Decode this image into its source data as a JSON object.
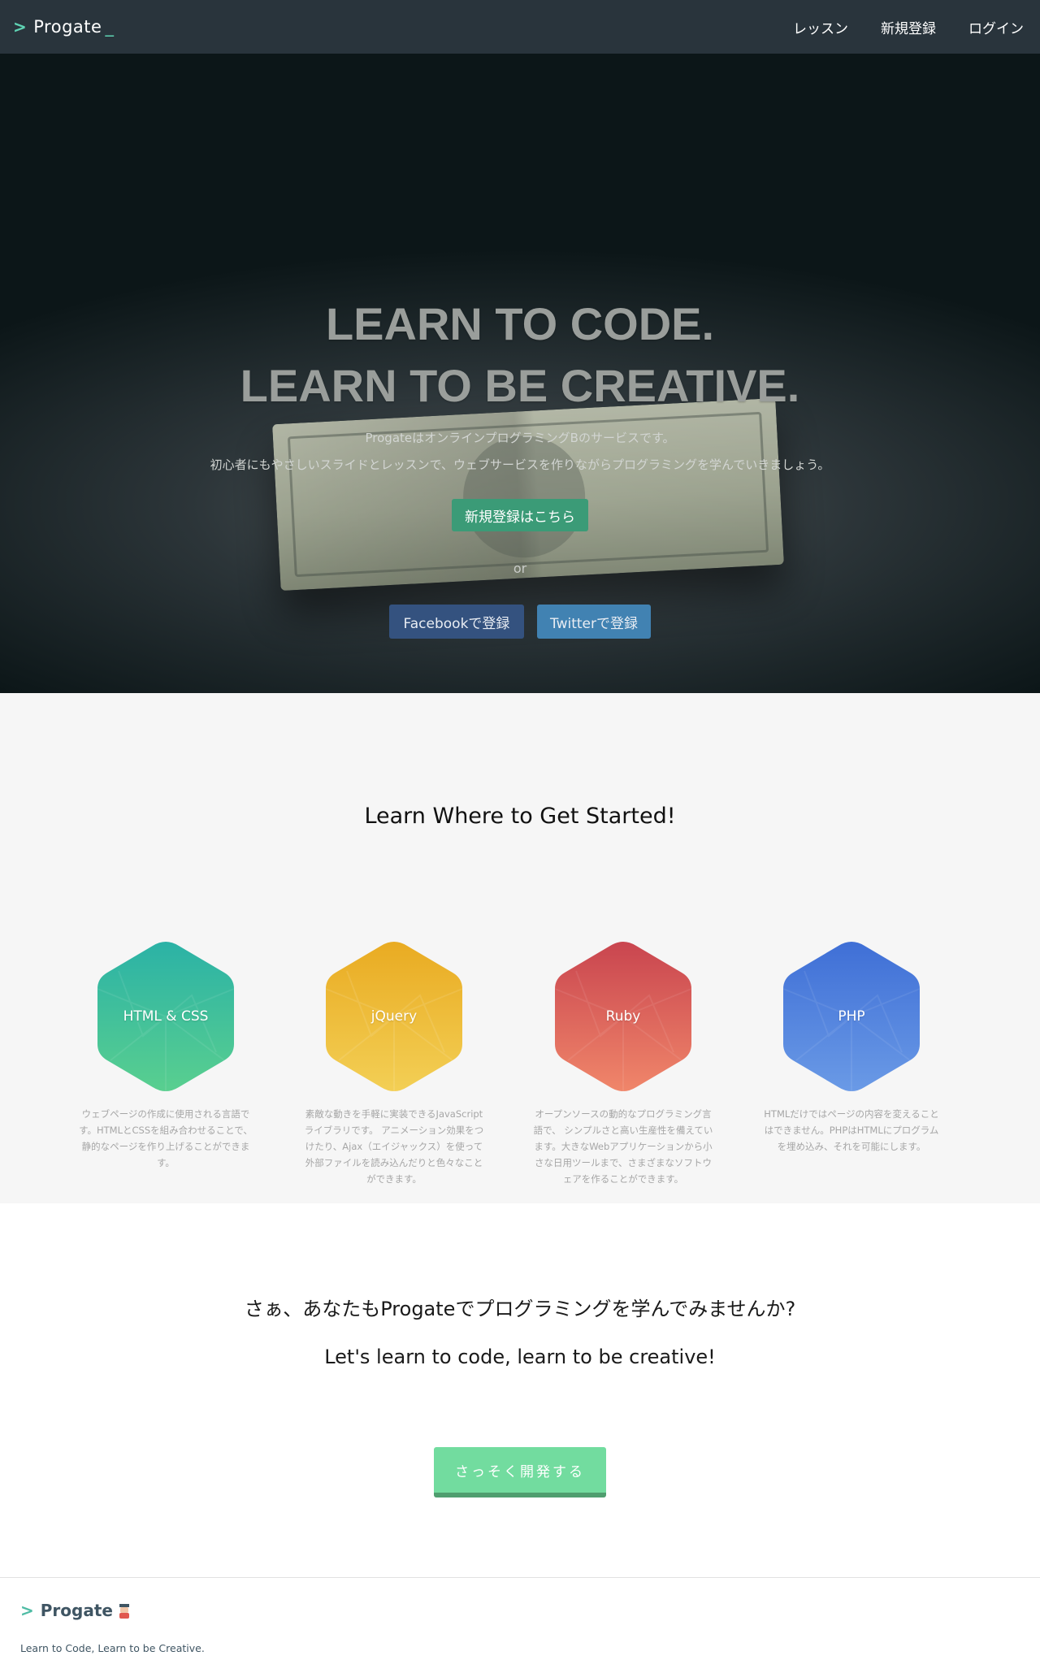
{
  "header": {
    "logo_text": "Progate",
    "logo_cursor": "_",
    "nav": [
      "レッスン",
      "新規登録",
      "ログイン"
    ]
  },
  "hero": {
    "title_line1": "LEARN TO CODE.",
    "title_line2": "LEARN TO BE CREATIVE.",
    "subtitle_line1": "ProgateはオンラインプログラミングBのサービスです。",
    "subtitle_line2": "初心者にもやさしいスライドとレッスンで、ウェブサービスを作りながらプログラミングを学んでいきましょう。",
    "signup_label": "新規登録はこちら",
    "or_label": "or",
    "facebook_label": "Facebookで登録",
    "twitter_label": "Twitterで登録"
  },
  "courses": {
    "title": "Learn Where to Get Started!",
    "items": [
      {
        "name": "HTML & CSS",
        "color_top": "#2bb2a6",
        "color_bottom": "#59cf8f",
        "desc": "ウェブページの作成に使用される言語です。HTMLとCSSを組み合わせることで、静的なページを作り上げることができます。"
      },
      {
        "name": "jQuery",
        "color_top": "#e9ab22",
        "color_bottom": "#f3cf55",
        "desc": "素敵な動きを手軽に実装できるJavaScriptライブラリです。 アニメーション効果をつけたり、Ajax（エイジャックス）を使って外部ファイルを読み込んだりと色々なことができます。"
      },
      {
        "name": "Ruby",
        "color_top": "#c9454f",
        "color_bottom": "#f0866a",
        "desc": "オープンソースの動的なプログラミング言語で、 シンプルさと高い生産性を備えています。大きなWebアプリケーションから小さな日用ツールまで、さまざまなソフトウェアを作ることができます。"
      },
      {
        "name": "PHP",
        "color_top": "#3f6fd6",
        "color_bottom": "#6a9ae6",
        "desc": "HTMLだけではページの内容を変えることはできません。PHPはHTMLにプログラムを埋め込み、それを可能にします。"
      }
    ]
  },
  "cta": {
    "jp_text": "さぁ、あなたもProgateでプログラミングを学んでみませんか?",
    "en_text": "Let's learn to code, learn to be creative!",
    "button_label": "さっそく開発する"
  },
  "footer": {
    "logo_text": "Progate",
    "tagline": "Learn to Code, Learn to be Creative."
  },
  "colors": {
    "header_bg": "#29343c",
    "accent": "#5fd3b4",
    "signup_btn": "#3b9b77",
    "facebook_btn": "#34527f",
    "twitter_btn": "#4182b2",
    "start_btn": "#72dc9f"
  }
}
